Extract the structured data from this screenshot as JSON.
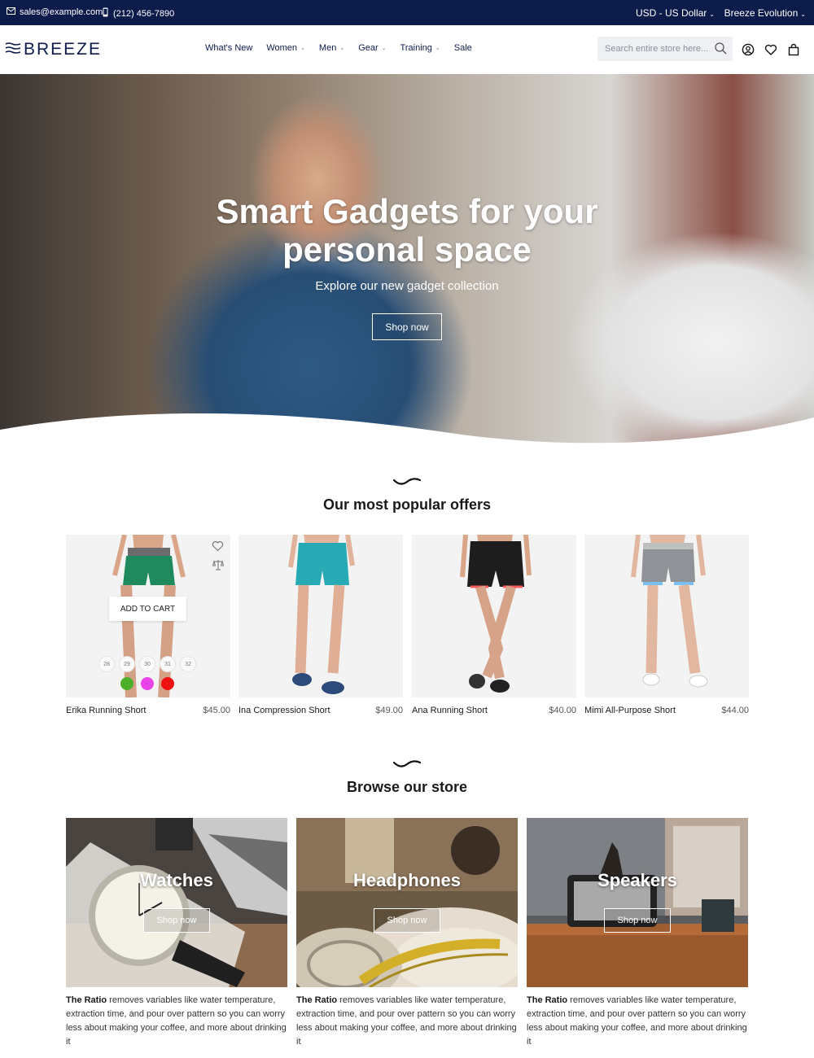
{
  "topbar": {
    "email": "sales@example.com",
    "phone": "(212) 456-7890",
    "currency": "USD - US Dollar",
    "store_switcher": "Breeze Evolution"
  },
  "header": {
    "logo_text": "BREEZE",
    "nav": [
      {
        "label": "What's New",
        "has_dropdown": false
      },
      {
        "label": "Women",
        "has_dropdown": true
      },
      {
        "label": "Men",
        "has_dropdown": true
      },
      {
        "label": "Gear",
        "has_dropdown": true
      },
      {
        "label": "Training",
        "has_dropdown": true
      },
      {
        "label": "Sale",
        "has_dropdown": false
      }
    ],
    "search_placeholder": "Search entire store here...",
    "icons": [
      "account-icon",
      "wishlist-icon",
      "cart-icon"
    ]
  },
  "hero": {
    "title": "Smart Gadgets for your personal space",
    "subtitle": "Explore our new gadget collection",
    "button": "Shop now"
  },
  "popular": {
    "title": "Our most popular offers",
    "products": [
      {
        "name": "Erika Running Short",
        "price": "$45.00",
        "add_to_cart": "ADD TO CART",
        "sizes": [
          "28",
          "29",
          "30",
          "31",
          "32"
        ],
        "colors": [
          "#4caf2a",
          "#e944e9",
          "#ef1111"
        ]
      },
      {
        "name": "Ina Compression Short",
        "price": "$49.00"
      },
      {
        "name": "Ana Running Short",
        "price": "$40.00"
      },
      {
        "name": "Mimi All-Purpose Short",
        "price": "$44.00"
      }
    ]
  },
  "browse": {
    "title": "Browse our store",
    "categories": [
      {
        "title": "Watches",
        "button": "Shop now",
        "desc_bold": "The Ratio",
        "desc": " removes variables like water temperature, extraction time, and pour over pattern so you can worry less about making your coffee, and more about drinking it"
      },
      {
        "title": "Headphones",
        "button": "Shop now",
        "desc_bold": "The Ratio",
        "desc": " removes variables like water temperature, extraction time, and pour over pattern so you can worry less about making your coffee, and more about drinking it"
      },
      {
        "title": "Speakers",
        "button": "Shop now",
        "desc_bold": "The Ratio",
        "desc": " removes variables like water temperature, extraction time, and pour over pattern so you can worry less about making your coffee, and more about drinking it"
      }
    ]
  },
  "colors": {
    "topbar_bg": "#0d1b4b",
    "brand_navy": "#0d1b4b"
  }
}
